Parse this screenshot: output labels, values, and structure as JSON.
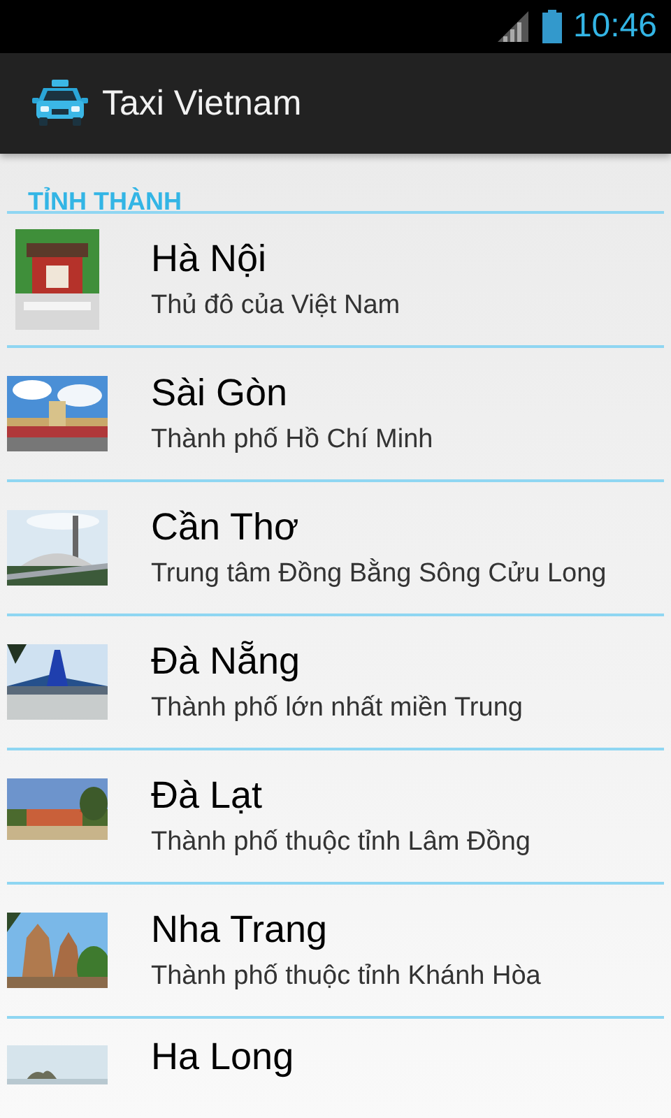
{
  "status_bar": {
    "time": "10:46"
  },
  "action_bar": {
    "title": "Taxi Vietnam"
  },
  "section": {
    "title": "TỈNH THÀNH"
  },
  "cities": [
    {
      "kind": "picture",
      "name": "Hà Nội",
      "description": "Thủ đô của Việt Nam"
    },
    {
      "kind": "picture",
      "name": "Sài Gòn",
      "description": "Thành phố Hồ Chí Minh"
    },
    {
      "kind": "picture",
      "name": "Cần Thơ",
      "description": "Trung tâm Đồng Bằng Sông Cửu Long"
    },
    {
      "kind": "picture",
      "name": "Đà Nẵng",
      "description": "Thành phố lớn nhất miền Trung"
    },
    {
      "kind": "picture",
      "name": "Đà Lạt",
      "description": "Thành phố thuộc tỉnh Lâm Đồng"
    },
    {
      "kind": "picture",
      "name": "Nha Trang",
      "description": "Thành phố thuộc tỉnh Khánh Hòa"
    },
    {
      "kind": "picture",
      "name": "Ha Long"
    }
  ]
}
